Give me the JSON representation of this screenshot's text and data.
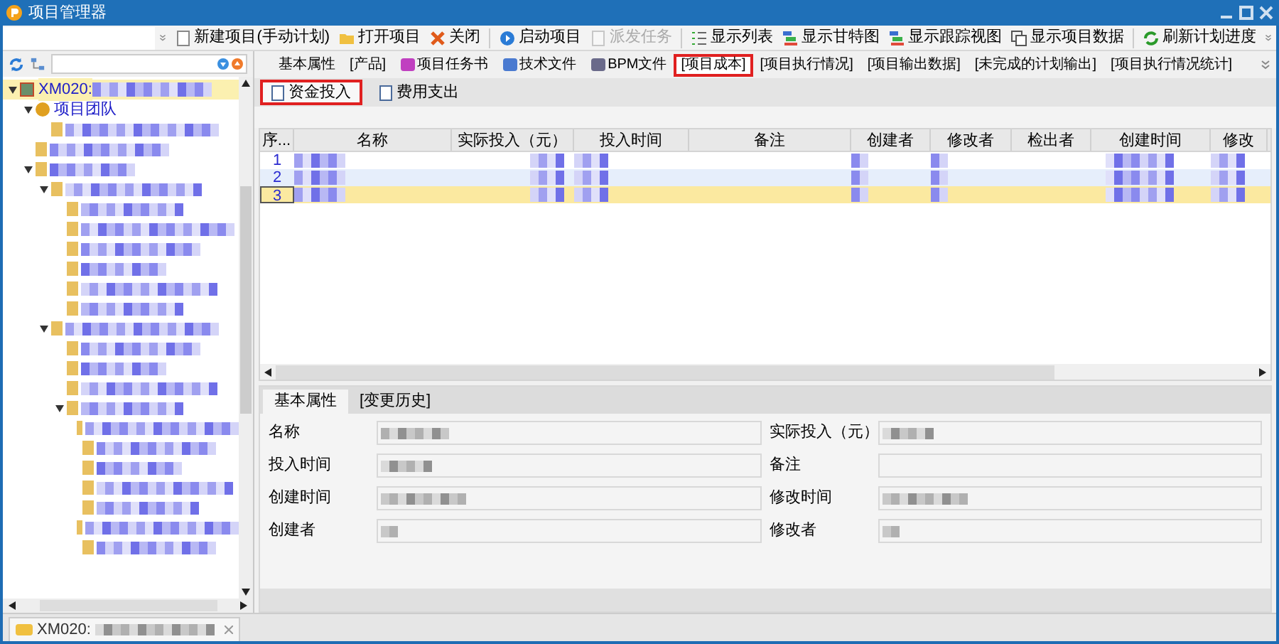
{
  "window": {
    "title": "项目管理器"
  },
  "toolbar": [
    {
      "label": "新建项目(手动计划)",
      "disabled": false
    },
    {
      "label": "打开项目",
      "disabled": false
    },
    {
      "label": "关闭",
      "disabled": false
    },
    {
      "label": "启动项目",
      "disabled": false
    },
    {
      "label": "派发任务",
      "disabled": true
    },
    {
      "label": "显示列表",
      "disabled": false
    },
    {
      "label": "显示甘特图",
      "disabled": false
    },
    {
      "label": "显示跟踪视图",
      "disabled": false
    },
    {
      "label": "显示项目数据",
      "disabled": false
    },
    {
      "label": "刷新计划进度",
      "disabled": false
    }
  ],
  "tree": [
    {
      "label": "XM020:",
      "selected": true,
      "children": [
        {
          "label": "项目团队",
          "selected": false,
          "children": [
            {
              "selected": false
            }
          ]
        },
        {
          "selected": false
        },
        {
          "selected": false,
          "children": [
            {
              "selected": false,
              "children": [
                {
                  "selected": false
                },
                {
                  "selected": false
                },
                {
                  "selected": false
                },
                {
                  "selected": false
                },
                {
                  "selected": false
                },
                {
                  "selected": false
                }
              ]
            },
            {
              "selected": false,
              "children": [
                {
                  "selected": false
                },
                {
                  "selected": false
                },
                {
                  "selected": false
                },
                {
                  "selected": false,
                  "children": [
                    {
                      "selected": false
                    },
                    {
                      "selected": false
                    },
                    {
                      "selected": false
                    },
                    {
                      "selected": false
                    },
                    {
                      "selected": false
                    },
                    {
                      "selected": false
                    },
                    {
                      "selected": false
                    }
                  ]
                }
              ]
            }
          ]
        }
      ]
    }
  ],
  "tabs": [
    {
      "label": "基本属性",
      "selected": false
    },
    {
      "label": "[产品]",
      "selected": false
    },
    {
      "label": "项目任务书",
      "selected": false
    },
    {
      "label": "技术文件",
      "selected": false
    },
    {
      "label": "BPM文件",
      "selected": false
    },
    {
      "label": "[项目成本]",
      "selected": true
    },
    {
      "label": "[项目执行情况]",
      "selected": false
    },
    {
      "label": "[项目输出数据]",
      "selected": false
    },
    {
      "label": "[未完成的计划输出]",
      "selected": false
    },
    {
      "label": "[项目执行情况统计]",
      "selected": false
    }
  ],
  "subtabs": [
    {
      "label": "资金投入",
      "selected": true
    },
    {
      "label": "费用支出",
      "selected": false
    }
  ],
  "table": {
    "columns": [
      "序...",
      "名称",
      "实际投入（元）",
      "投入时间",
      "备注",
      "创建者",
      "修改者",
      "检出者",
      "创建时间",
      "修改"
    ],
    "rows": [
      {
        "number": "1",
        "selected": false
      },
      {
        "number": "2",
        "selected": false
      },
      {
        "number": "3",
        "selected": true
      }
    ]
  },
  "detail": {
    "tabs": [
      {
        "label": "基本属性",
        "selected": true
      },
      {
        "label": "[变更历史]",
        "selected": false
      }
    ],
    "fields": [
      {
        "label": "名称"
      },
      {
        "label": "实际投入（元）"
      },
      {
        "label": "投入时间"
      },
      {
        "label": "备注"
      },
      {
        "label": "创建时间"
      },
      {
        "label": "修改时间"
      },
      {
        "label": "创建者"
      },
      {
        "label": "修改者"
      }
    ]
  },
  "documents": [
    {
      "label": "XM020:",
      "selected": true
    }
  ]
}
